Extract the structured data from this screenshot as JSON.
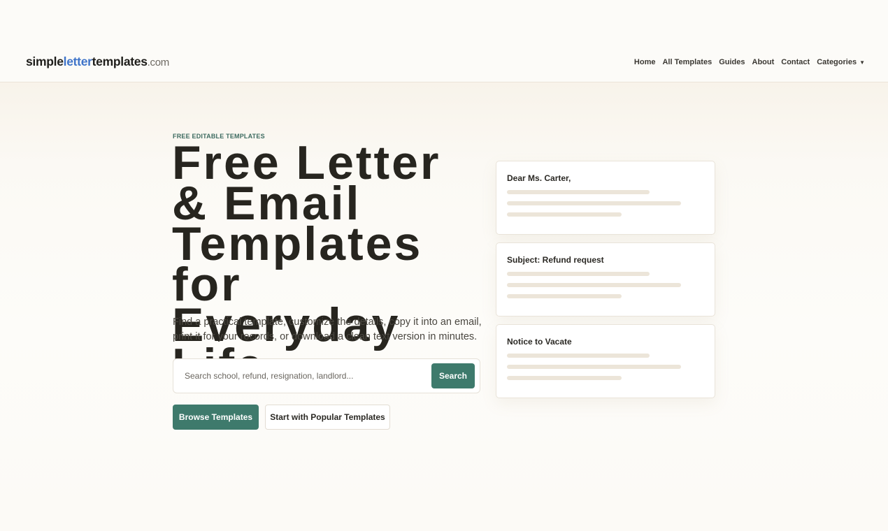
{
  "header": {
    "logo": {
      "part1": "simple",
      "part2": "letter",
      "part3": "templates",
      "part4": ".com"
    },
    "nav": [
      {
        "label": "Home"
      },
      {
        "label": "All Templates"
      },
      {
        "label": "Guides"
      },
      {
        "label": "About"
      },
      {
        "label": "Contact"
      },
      {
        "label": "Categories",
        "icon": "caret-down-icon"
      }
    ]
  },
  "hero": {
    "eyebrow": "FREE EDITABLE TEMPLATES",
    "title": "Free Letter & Email Templates for Everyday Life",
    "description": "Find a practical template, customize the details, copy it into an email, print it for your records, or download a clean text version in minutes.",
    "search": {
      "placeholder": "Search school, refund, resignation, landlord...",
      "value": "",
      "button_label": "Search"
    },
    "buttons": {
      "browse": "Browse Templates",
      "popular": "Start with Popular Templates"
    }
  },
  "preview_cards": [
    {
      "title": "Dear Ms. Carter,"
    },
    {
      "title": "Subject: Refund request"
    },
    {
      "title": "Notice to Vacate"
    }
  ],
  "colors": {
    "accent": "#3e7a6c",
    "logo_blue": "#3f74c9",
    "background": "#fcfbf8",
    "text": "#27251f",
    "placeholder_line": "#ece5d9"
  }
}
